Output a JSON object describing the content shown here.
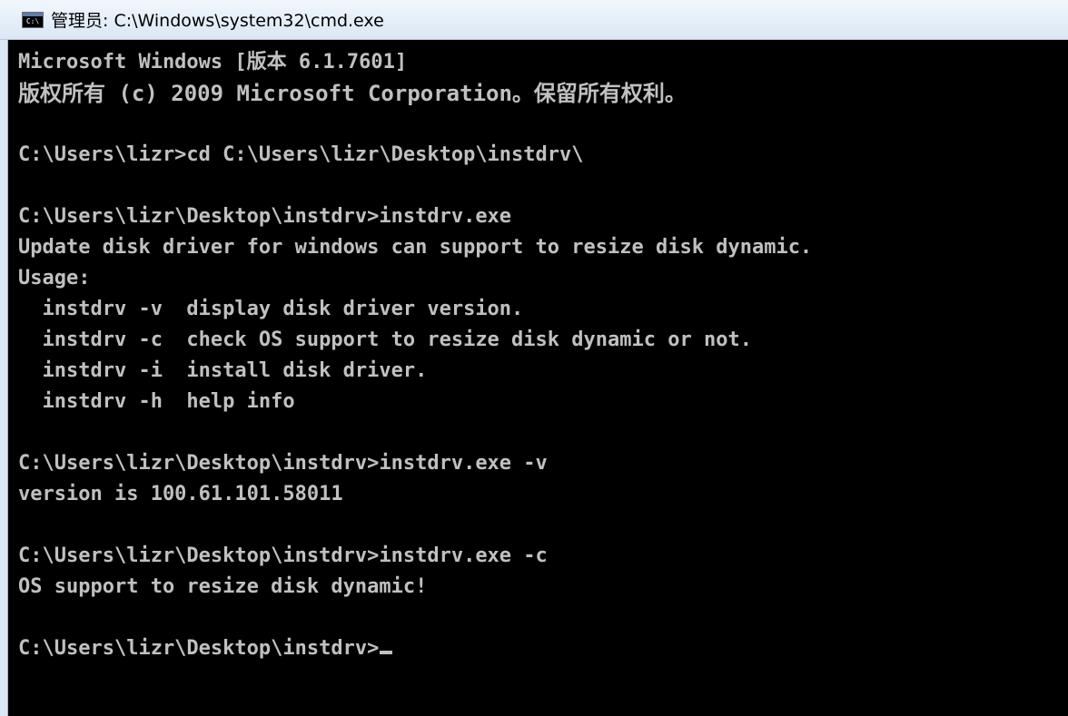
{
  "window": {
    "title": "管理员: C:\\Windows\\system32\\cmd.exe",
    "icon_name": "cmd-icon",
    "icon_text": "C:\\"
  },
  "console": {
    "lines": [
      "Microsoft Windows [版本 6.1.7601]",
      "版权所有 (c) 2009 Microsoft Corporation。保留所有权利。",
      "",
      "C:\\Users\\lizr>cd C:\\Users\\lizr\\Desktop\\instdrv\\",
      "",
      "C:\\Users\\lizr\\Desktop\\instdrv>instdrv.exe",
      "Update disk driver for windows can support to resize disk dynamic.",
      "Usage:",
      "  instdrv -v  display disk driver version.",
      "  instdrv -c  check OS support to resize disk dynamic or not.",
      "  instdrv -i  install disk driver.",
      "  instdrv -h  help info",
      "",
      "C:\\Users\\lizr\\Desktop\\instdrv>instdrv.exe -v",
      "version is 100.61.101.58011",
      "",
      "C:\\Users\\lizr\\Desktop\\instdrv>instdrv.exe -c",
      "OS support to resize disk dynamic!",
      "",
      "C:\\Users\\lizr\\Desktop\\instdrv>"
    ]
  },
  "colors": {
    "background": "#000000",
    "text": "#c0c0c0",
    "titlebar": "#dbe7f5"
  }
}
